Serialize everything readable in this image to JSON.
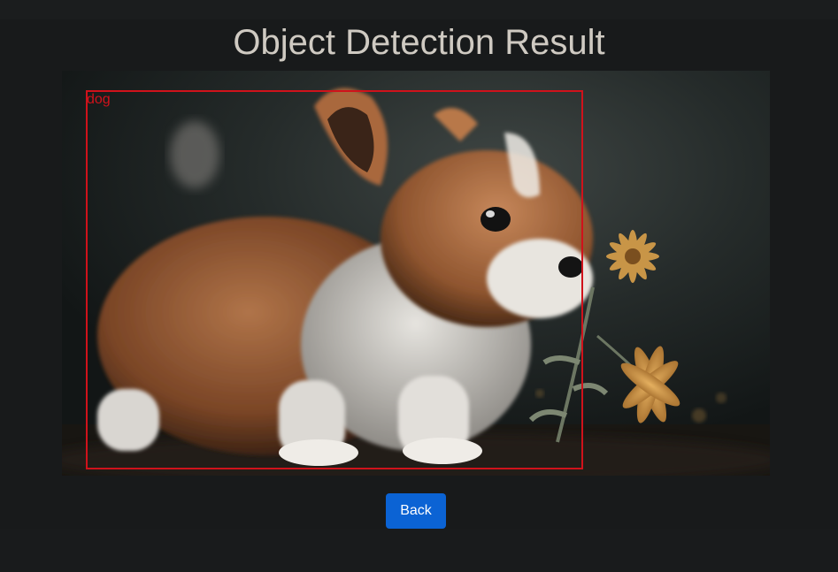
{
  "page": {
    "title": "Object Detection Result"
  },
  "detection": {
    "image_description_icon": "puppy-photo",
    "boxes": [
      {
        "label": "dog",
        "color": "#d0121b"
      }
    ]
  },
  "actions": {
    "back_label": "Back"
  },
  "colors": {
    "background": "#181a1b",
    "title_text": "#cfcac2",
    "button": "#0b63d4",
    "box": "#d0121b"
  }
}
